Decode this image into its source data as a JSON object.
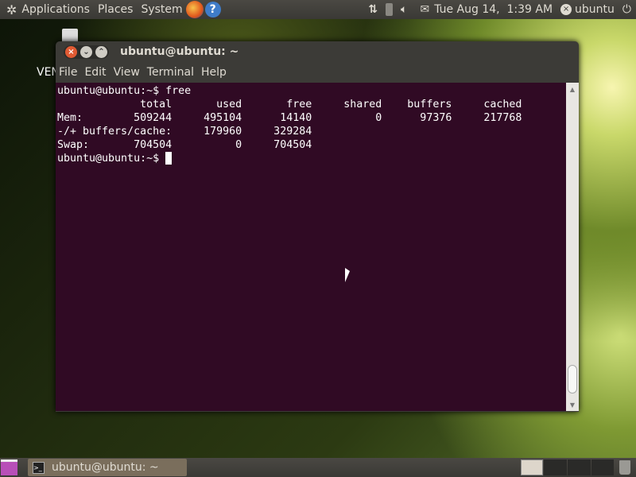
{
  "top_panel": {
    "menus": [
      "Applications",
      "Places",
      "System"
    ],
    "clock": "Tue Aug 14,  1:39 AM",
    "user": "ubuntu"
  },
  "desktop": {
    "partial_label": "VEN"
  },
  "window": {
    "title": "ubuntu@ubuntu: ~",
    "menu": [
      "File",
      "Edit",
      "View",
      "Terminal",
      "Help"
    ]
  },
  "terminal": {
    "lines": [
      "ubuntu@ubuntu:~$ free",
      "             total       used       free     shared    buffers     cached",
      "Mem:        509244     495104      14140          0      97376     217768",
      "-/+ buffers/cache:     179960     329284",
      "Swap:       704504          0     704504"
    ],
    "prompt": "ubuntu@ubuntu:~$ "
  },
  "taskbar": {
    "task_label": "ubuntu@ubuntu: ~"
  },
  "colors": {
    "terminal_bg": "#300a24",
    "panel": "#3c3b37"
  }
}
